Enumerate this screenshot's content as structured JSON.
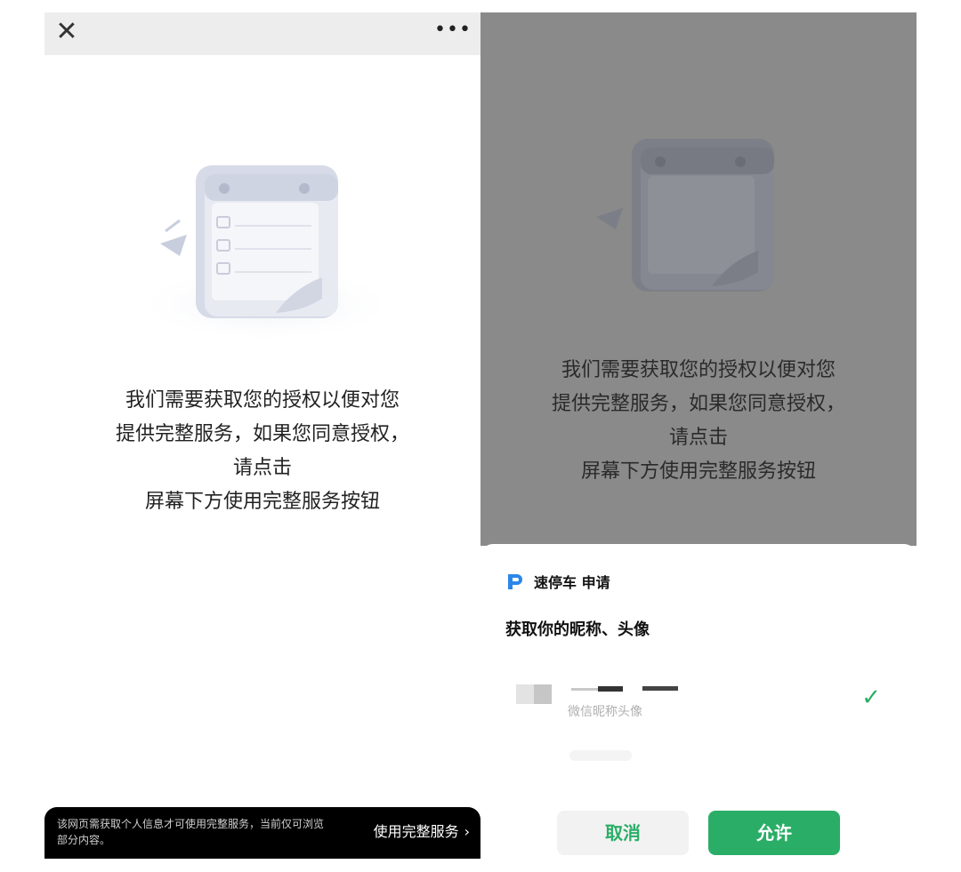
{
  "left_screen": {
    "topbar": {
      "close_icon": "close-icon",
      "more_icon": "more-icon"
    },
    "message": [
      "我们需要获取您的授权以便对您",
      "提供完整服务，如果您同意授权，",
      "请点击",
      "屏幕下方使用完整服务按钮"
    ],
    "footer": {
      "note": "该网页需获取个人信息才可使用完整服务，当前仅可浏览部分内容。",
      "button": "使用完整服务",
      "chevron": "›"
    }
  },
  "right_screen": {
    "message": [
      "我们需要获取您的授权以便对您",
      "提供完整服务，如果您同意授权，",
      "请点击",
      "屏幕下方使用完整服务按钮"
    ],
    "sheet": {
      "app_name": "速停车 申请",
      "request_title": "获取你的昵称、头像",
      "profile_sub": "微信昵称头像",
      "check_icon": "✓",
      "cancel": "取消",
      "allow": "允许"
    }
  },
  "colors": {
    "accent": "#2aae67",
    "overlay": "#8a8a8a",
    "logo": "#2b86e8"
  }
}
